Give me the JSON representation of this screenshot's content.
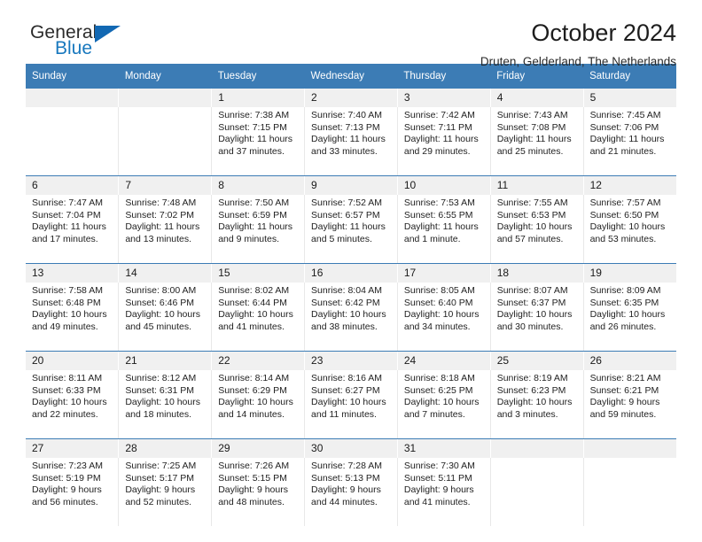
{
  "brand": {
    "name_part1": "General",
    "name_part2": "Blue",
    "triangle_color": "#1268b3",
    "blue_text_color": "#1878be"
  },
  "header": {
    "title": "October 2024",
    "subtitle": "Druten, Gelderland, The Netherlands"
  },
  "theme": {
    "header_blue": "#3c7cb5",
    "daynum_band": "#f0f0f0",
    "text": "#222222"
  },
  "calendar": {
    "weekday_headers": [
      "Sunday",
      "Monday",
      "Tuesday",
      "Wednesday",
      "Thursday",
      "Friday",
      "Saturday"
    ],
    "weeks": [
      {
        "days": [
          {
            "date": "",
            "lines": []
          },
          {
            "date": "",
            "lines": []
          },
          {
            "date": "1",
            "lines": [
              "Sunrise: 7:38 AM",
              "Sunset: 7:15 PM",
              "Daylight: 11 hours",
              "and 37 minutes."
            ]
          },
          {
            "date": "2",
            "lines": [
              "Sunrise: 7:40 AM",
              "Sunset: 7:13 PM",
              "Daylight: 11 hours",
              "and 33 minutes."
            ]
          },
          {
            "date": "3",
            "lines": [
              "Sunrise: 7:42 AM",
              "Sunset: 7:11 PM",
              "Daylight: 11 hours",
              "and 29 minutes."
            ]
          },
          {
            "date": "4",
            "lines": [
              "Sunrise: 7:43 AM",
              "Sunset: 7:08 PM",
              "Daylight: 11 hours",
              "and 25 minutes."
            ]
          },
          {
            "date": "5",
            "lines": [
              "Sunrise: 7:45 AM",
              "Sunset: 7:06 PM",
              "Daylight: 11 hours",
              "and 21 minutes."
            ]
          }
        ]
      },
      {
        "days": [
          {
            "date": "6",
            "lines": [
              "Sunrise: 7:47 AM",
              "Sunset: 7:04 PM",
              "Daylight: 11 hours",
              "and 17 minutes."
            ]
          },
          {
            "date": "7",
            "lines": [
              "Sunrise: 7:48 AM",
              "Sunset: 7:02 PM",
              "Daylight: 11 hours",
              "and 13 minutes."
            ]
          },
          {
            "date": "8",
            "lines": [
              "Sunrise: 7:50 AM",
              "Sunset: 6:59 PM",
              "Daylight: 11 hours",
              "and 9 minutes."
            ]
          },
          {
            "date": "9",
            "lines": [
              "Sunrise: 7:52 AM",
              "Sunset: 6:57 PM",
              "Daylight: 11 hours",
              "and 5 minutes."
            ]
          },
          {
            "date": "10",
            "lines": [
              "Sunrise: 7:53 AM",
              "Sunset: 6:55 PM",
              "Daylight: 11 hours",
              "and 1 minute."
            ]
          },
          {
            "date": "11",
            "lines": [
              "Sunrise: 7:55 AM",
              "Sunset: 6:53 PM",
              "Daylight: 10 hours",
              "and 57 minutes."
            ]
          },
          {
            "date": "12",
            "lines": [
              "Sunrise: 7:57 AM",
              "Sunset: 6:50 PM",
              "Daylight: 10 hours",
              "and 53 minutes."
            ]
          }
        ]
      },
      {
        "days": [
          {
            "date": "13",
            "lines": [
              "Sunrise: 7:58 AM",
              "Sunset: 6:48 PM",
              "Daylight: 10 hours",
              "and 49 minutes."
            ]
          },
          {
            "date": "14",
            "lines": [
              "Sunrise: 8:00 AM",
              "Sunset: 6:46 PM",
              "Daylight: 10 hours",
              "and 45 minutes."
            ]
          },
          {
            "date": "15",
            "lines": [
              "Sunrise: 8:02 AM",
              "Sunset: 6:44 PM",
              "Daylight: 10 hours",
              "and 41 minutes."
            ]
          },
          {
            "date": "16",
            "lines": [
              "Sunrise: 8:04 AM",
              "Sunset: 6:42 PM",
              "Daylight: 10 hours",
              "and 38 minutes."
            ]
          },
          {
            "date": "17",
            "lines": [
              "Sunrise: 8:05 AM",
              "Sunset: 6:40 PM",
              "Daylight: 10 hours",
              "and 34 minutes."
            ]
          },
          {
            "date": "18",
            "lines": [
              "Sunrise: 8:07 AM",
              "Sunset: 6:37 PM",
              "Daylight: 10 hours",
              "and 30 minutes."
            ]
          },
          {
            "date": "19",
            "lines": [
              "Sunrise: 8:09 AM",
              "Sunset: 6:35 PM",
              "Daylight: 10 hours",
              "and 26 minutes."
            ]
          }
        ]
      },
      {
        "days": [
          {
            "date": "20",
            "lines": [
              "Sunrise: 8:11 AM",
              "Sunset: 6:33 PM",
              "Daylight: 10 hours",
              "and 22 minutes."
            ]
          },
          {
            "date": "21",
            "lines": [
              "Sunrise: 8:12 AM",
              "Sunset: 6:31 PM",
              "Daylight: 10 hours",
              "and 18 minutes."
            ]
          },
          {
            "date": "22",
            "lines": [
              "Sunrise: 8:14 AM",
              "Sunset: 6:29 PM",
              "Daylight: 10 hours",
              "and 14 minutes."
            ]
          },
          {
            "date": "23",
            "lines": [
              "Sunrise: 8:16 AM",
              "Sunset: 6:27 PM",
              "Daylight: 10 hours",
              "and 11 minutes."
            ]
          },
          {
            "date": "24",
            "lines": [
              "Sunrise: 8:18 AM",
              "Sunset: 6:25 PM",
              "Daylight: 10 hours",
              "and 7 minutes."
            ]
          },
          {
            "date": "25",
            "lines": [
              "Sunrise: 8:19 AM",
              "Sunset: 6:23 PM",
              "Daylight: 10 hours",
              "and 3 minutes."
            ]
          },
          {
            "date": "26",
            "lines": [
              "Sunrise: 8:21 AM",
              "Sunset: 6:21 PM",
              "Daylight: 9 hours",
              "and 59 minutes."
            ]
          }
        ]
      },
      {
        "days": [
          {
            "date": "27",
            "lines": [
              "Sunrise: 7:23 AM",
              "Sunset: 5:19 PM",
              "Daylight: 9 hours",
              "and 56 minutes."
            ]
          },
          {
            "date": "28",
            "lines": [
              "Sunrise: 7:25 AM",
              "Sunset: 5:17 PM",
              "Daylight: 9 hours",
              "and 52 minutes."
            ]
          },
          {
            "date": "29",
            "lines": [
              "Sunrise: 7:26 AM",
              "Sunset: 5:15 PM",
              "Daylight: 9 hours",
              "and 48 minutes."
            ]
          },
          {
            "date": "30",
            "lines": [
              "Sunrise: 7:28 AM",
              "Sunset: 5:13 PM",
              "Daylight: 9 hours",
              "and 44 minutes."
            ]
          },
          {
            "date": "31",
            "lines": [
              "Sunrise: 7:30 AM",
              "Sunset: 5:11 PM",
              "Daylight: 9 hours",
              "and 41 minutes."
            ]
          },
          {
            "date": "",
            "lines": []
          },
          {
            "date": "",
            "lines": []
          }
        ]
      }
    ]
  }
}
